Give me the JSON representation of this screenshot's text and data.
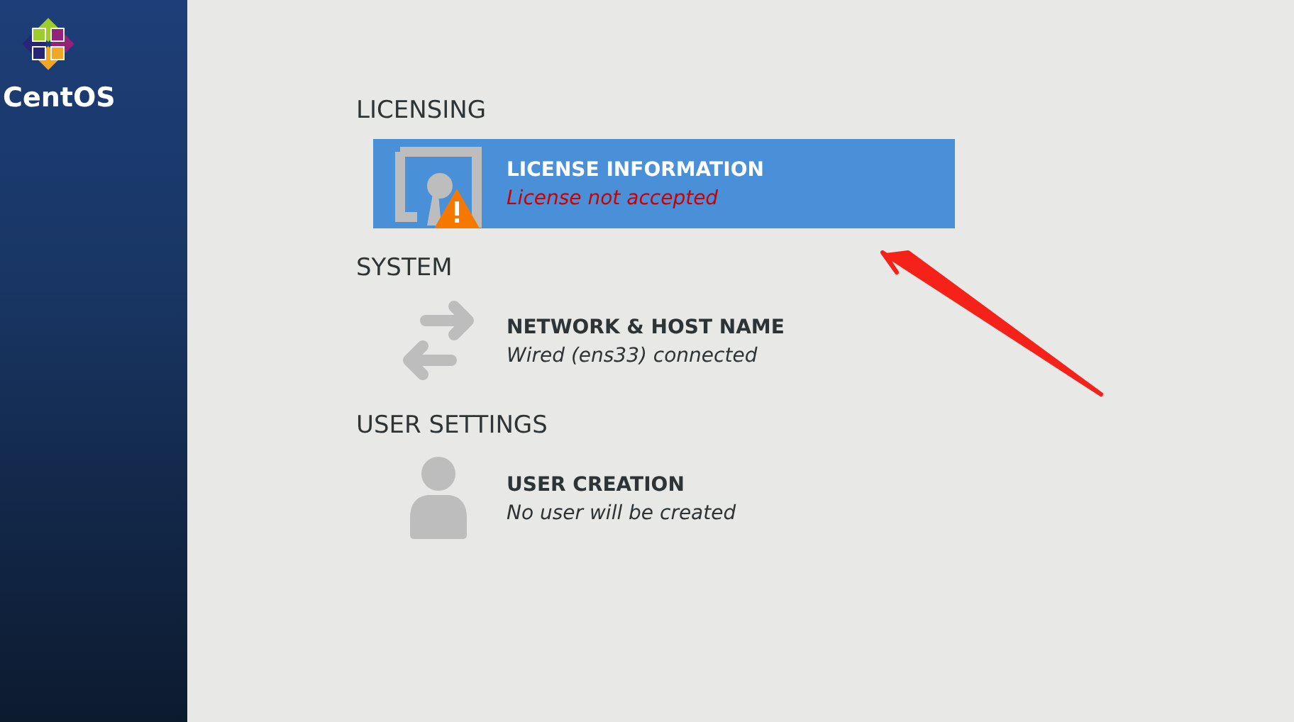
{
  "sidebar": {
    "logo_text": "CentOS"
  },
  "sections": [
    {
      "heading": "LICENSING",
      "items": [
        {
          "kind": "license",
          "title": "LICENSE INFORMATION",
          "status": "License not accepted",
          "warning": true,
          "selected": true
        }
      ]
    },
    {
      "heading": "SYSTEM",
      "items": [
        {
          "kind": "network",
          "title": "NETWORK & HOST NAME",
          "status": "Wired (ens33) connected",
          "warning": false,
          "selected": false
        }
      ]
    },
    {
      "heading": "USER SETTINGS",
      "items": [
        {
          "kind": "user",
          "title": "USER CREATION",
          "status": "No user will be created",
          "warning": false,
          "selected": false
        }
      ]
    }
  ]
}
